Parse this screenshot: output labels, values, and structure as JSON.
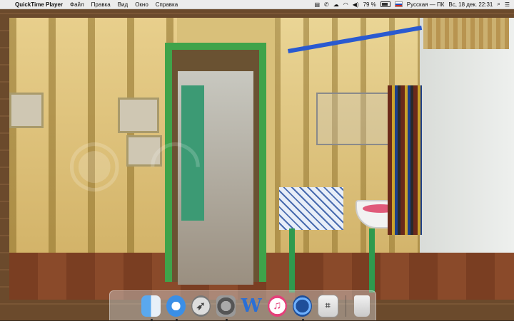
{
  "menubar": {
    "app_name": "QuickTime Player",
    "items": [
      "Файл",
      "Правка",
      "Вид",
      "Окно",
      "Справка"
    ],
    "status": {
      "battery_percent": "79 %",
      "input_source": "Русская — ПК",
      "clock": "Вс, 18 дек.  22:31"
    }
  },
  "dock": {
    "apps": [
      {
        "name": "finder-icon"
      },
      {
        "name": "safari-icon"
      },
      {
        "name": "launchpad-icon"
      },
      {
        "name": "system-preferences-icon"
      },
      {
        "name": "word-icon",
        "glyph": "W"
      },
      {
        "name": "itunes-icon",
        "glyph": "♫"
      },
      {
        "name": "quicktime-icon"
      },
      {
        "name": "preview-icon"
      },
      {
        "name": "trash-icon"
      }
    ]
  },
  "colors": {
    "menubar_bg": "#ececec",
    "door_frame": "#3fa34a",
    "accent_blue": "#2a5ad0"
  }
}
